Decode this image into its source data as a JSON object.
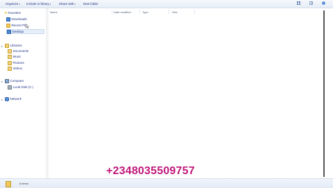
{
  "toolbar": {
    "organize": "Organize",
    "include_in_library": "Include in library",
    "share_with": "Share with",
    "new_folder": "New folder"
  },
  "nav": {
    "favorites": "Favorites",
    "downloads": "Downloads",
    "recent_places": "Recent Pla",
    "desktop": "Desktop",
    "libraries": "Libraries",
    "documents": "Documents",
    "music": "Music",
    "pictures": "Pictures",
    "videos": "Videos",
    "computer": "Computer",
    "local_disk": "Local Disk (C:)",
    "network": "Network"
  },
  "columns": {
    "name": "Name",
    "date_modified": "Date modified",
    "type": "Type",
    "size": "Size"
  },
  "status": {
    "item_count": "6 items"
  },
  "overlay": {
    "phone": "+2348035509757"
  },
  "colors": {
    "overlay_text": "#c0177a",
    "link_text": "#1e3287",
    "selected_bg": "#e5eef9"
  }
}
